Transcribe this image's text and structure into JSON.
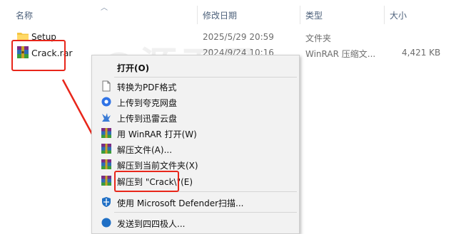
{
  "columns": {
    "name": "名称",
    "modified": "修改日期",
    "type": "类型",
    "size": "大小"
  },
  "files": [
    {
      "name": "Setup",
      "modified": "2025/5/29 20:59",
      "type": "文件夹",
      "size": "",
      "icon": "folder-icon",
      "selected": false
    },
    {
      "name": "Crack.rar",
      "modified": "2024/9/24 10:16",
      "type": "WinRAR 压缩文...",
      "size": "4,421 KB",
      "icon": "winrar-archive-icon",
      "selected": true
    }
  ],
  "watermark": "@源于风",
  "context_menu": {
    "items": [
      {
        "label": "打开(O)",
        "icon": "none",
        "bold": true
      },
      {
        "label": "转换为PDF格式",
        "icon": "document-icon"
      },
      {
        "label": "上传到夸克网盘",
        "icon": "quark-icon"
      },
      {
        "label": "上传到迅雷云盘",
        "icon": "xunlei-icon"
      },
      {
        "label": "用 WinRAR 打开(W)",
        "icon": "winrar-icon"
      },
      {
        "label": "解压文件(A)...",
        "icon": "winrar-icon"
      },
      {
        "label": "解压到当前文件夹(X)",
        "icon": "winrar-icon"
      },
      {
        "label": "解压到 \"Crack\\\"(E)",
        "icon": "winrar-icon"
      },
      {
        "label": "使用 Microsoft Defender扫描...",
        "icon": "defender-shield-icon"
      },
      {
        "label": "发送到四四极人...",
        "icon": "share-icon"
      }
    ]
  },
  "colors": {
    "selection": "#cce8ff",
    "highlight_red": "#e8261a",
    "menu_bg": "#f2f2f2",
    "header_text": "#4c607a"
  }
}
